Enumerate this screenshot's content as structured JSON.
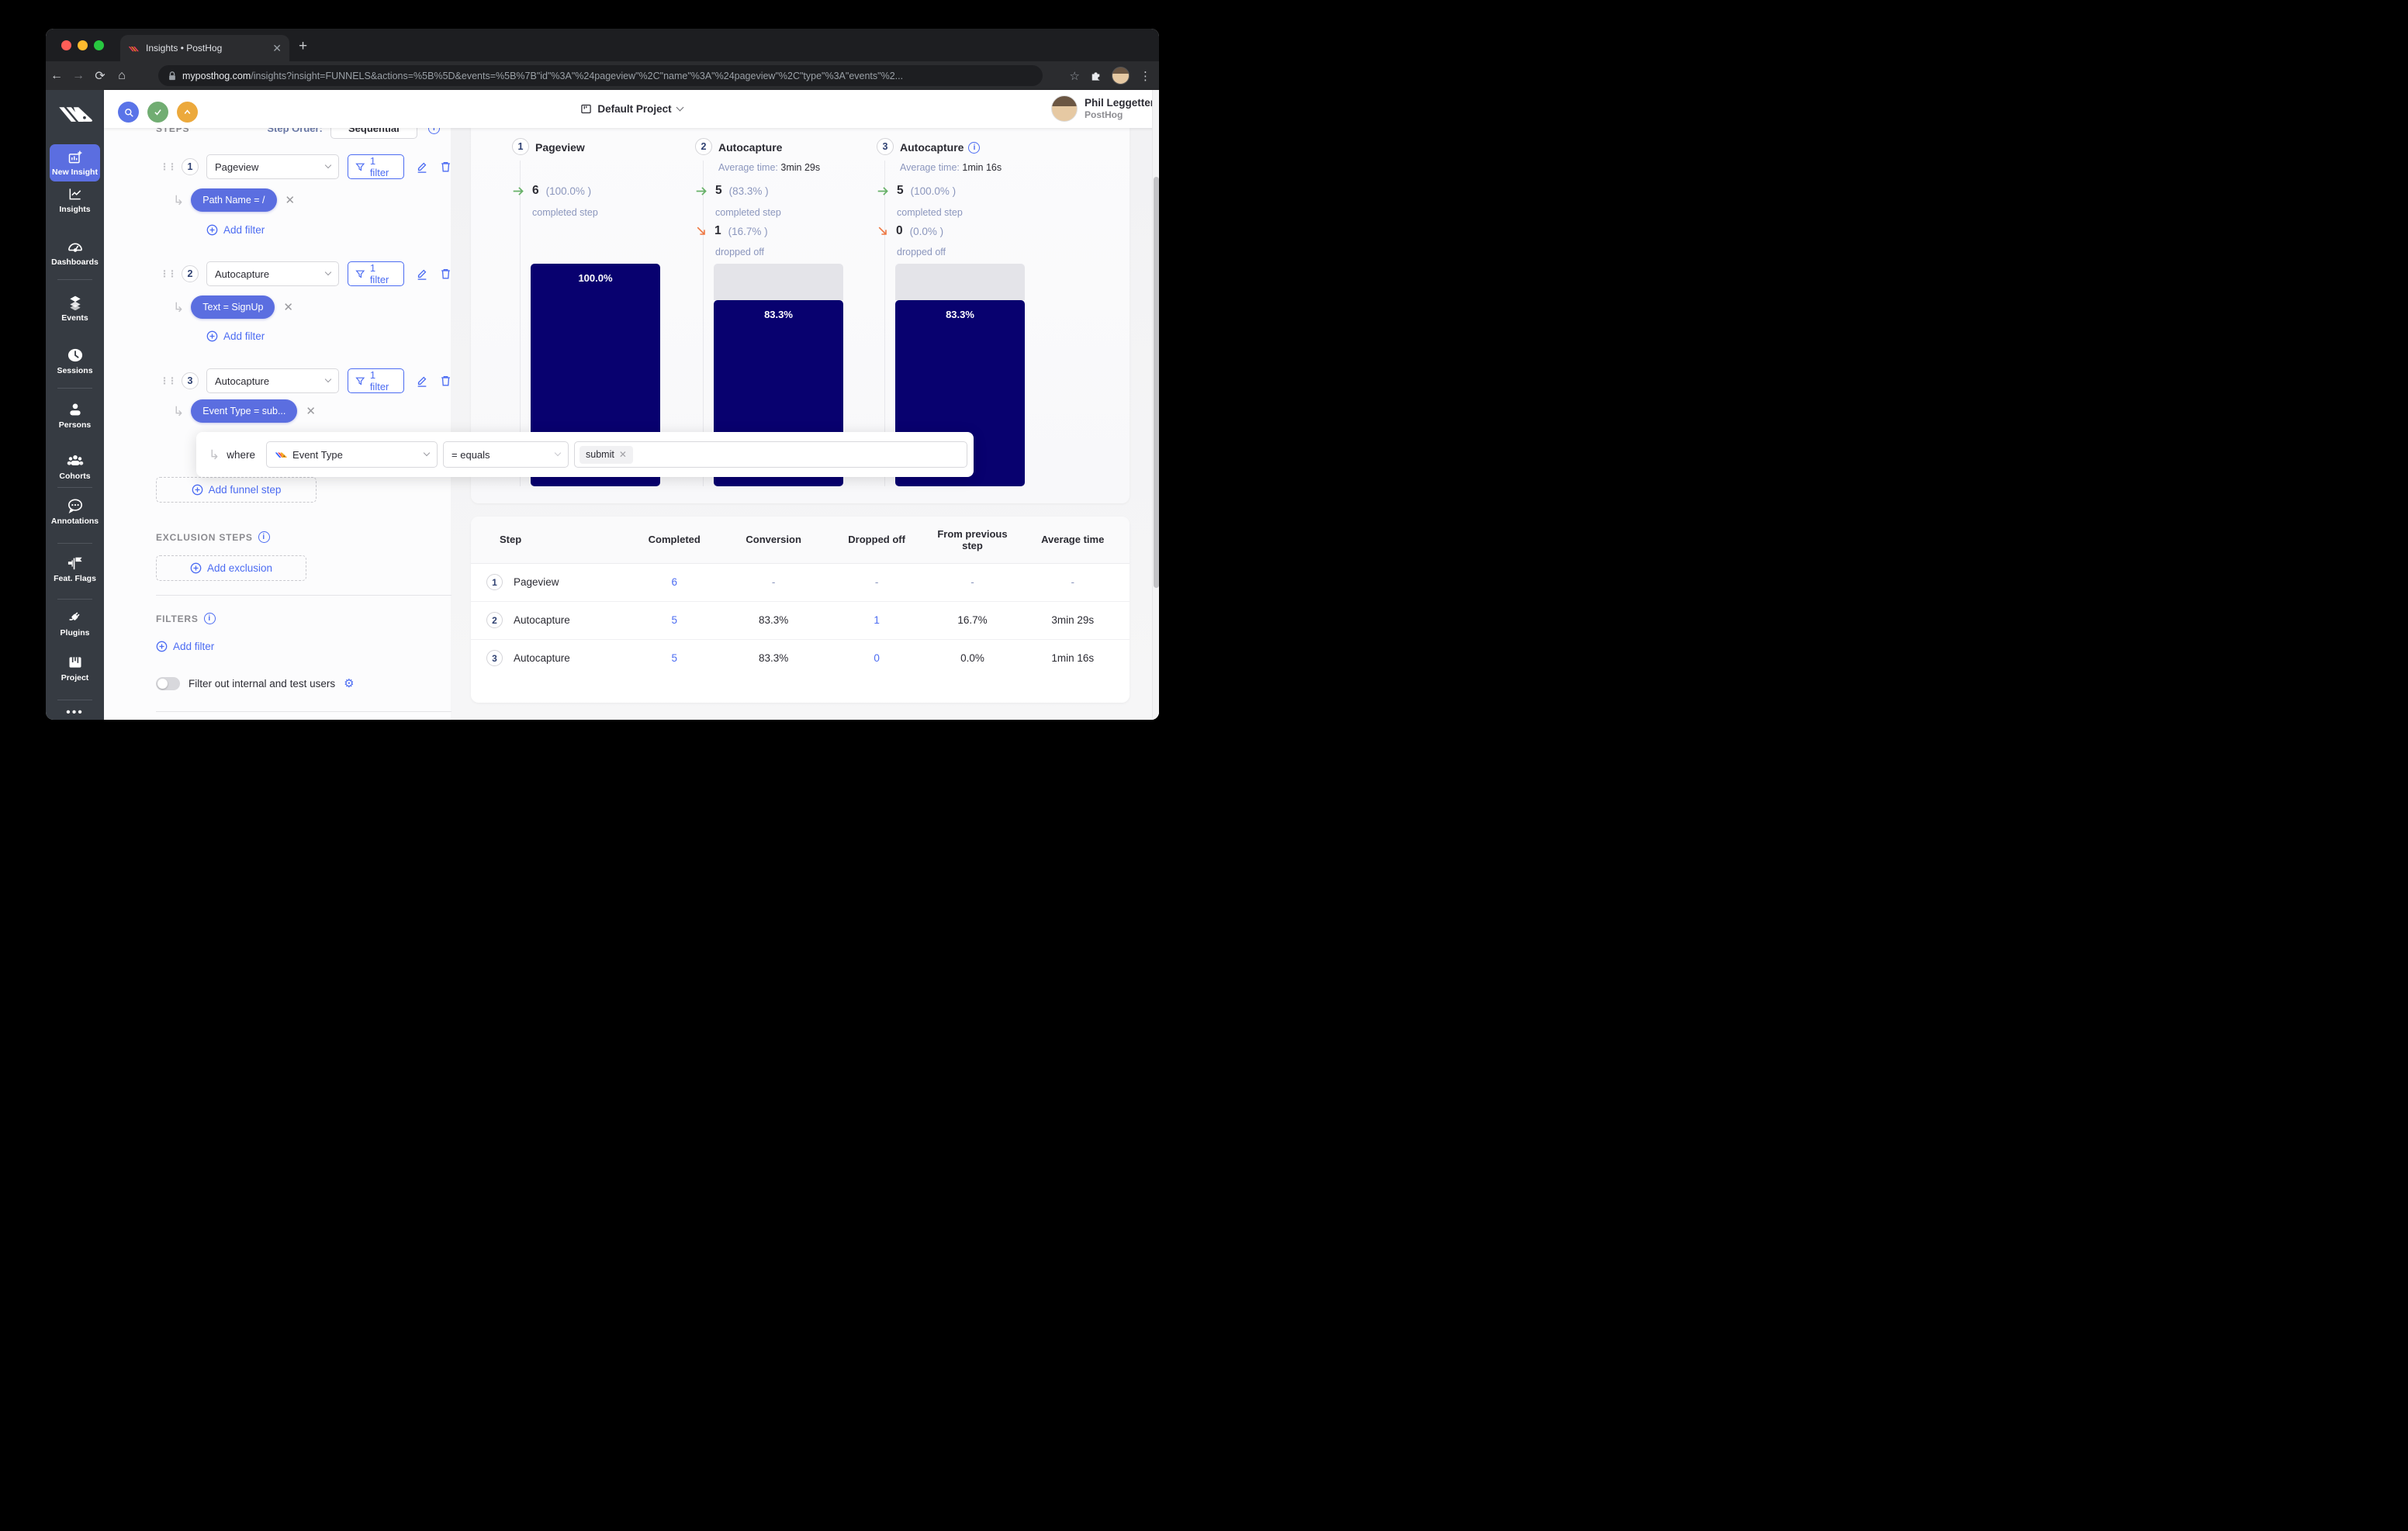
{
  "browser": {
    "tab_title": "Insights • PostHog",
    "new_tab_label": "+",
    "url_domain": "myposthog.com",
    "url_path": "/insights?insight=FUNNELS&actions=%5B%5D&events=%5B%7B\"id\"%3A\"%24pageview\"%2C\"name\"%3A\"%24pageview\"%2C\"type\"%3A\"events\"%2..."
  },
  "sidebar": {
    "items": [
      {
        "label": "New Insight"
      },
      {
        "label": "Insights"
      },
      {
        "label": "Dashboards"
      },
      {
        "label": "Events"
      },
      {
        "label": "Sessions"
      },
      {
        "label": "Persons"
      },
      {
        "label": "Cohorts"
      },
      {
        "label": "Annotations"
      },
      {
        "label": "Feat. Flags"
      },
      {
        "label": "Plugins"
      },
      {
        "label": "Project"
      }
    ]
  },
  "header": {
    "project_name": "Default Project",
    "user_name": "Phil Leggetter",
    "user_org": "PostHog"
  },
  "config": {
    "section_label": "STEPS",
    "step_order_label": "Step Order:",
    "step_order_value": "Sequential",
    "steps": [
      {
        "num": "1",
        "event": "Pageview",
        "filter_button": "1 filter",
        "pill": "Path Name = /",
        "add_filter": "Add filter"
      },
      {
        "num": "2",
        "event": "Autocapture",
        "filter_button": "1 filter",
        "pill": "Text = SignUp",
        "add_filter": "Add filter"
      },
      {
        "num": "3",
        "event": "Autocapture",
        "filter_button": "1 filter",
        "pill": "Event Type = sub..."
      }
    ],
    "where_row": {
      "prefix": "where",
      "property": "Event Type",
      "operator": "= equals",
      "value_tag": "submit"
    },
    "add_funnel_step": "Add funnel step",
    "exclusions": {
      "label": "EXCLUSION STEPS",
      "button": "Add exclusion"
    },
    "filters": {
      "label": "FILTERS",
      "add_filter": "Add filter",
      "toggle_label": "Filter out internal and test users"
    }
  },
  "funnel": {
    "columns": [
      {
        "num": "1",
        "title": "Pageview",
        "completed": "6",
        "completed_pct": "(100.0% )",
        "completed_label": "completed step",
        "bar_label": "100.0%"
      },
      {
        "num": "2",
        "title": "Autocapture",
        "avg_time_label": "Average time:",
        "avg_time": "3min 29s",
        "completed": "5",
        "completed_pct": "(83.3% )",
        "completed_label": "completed step",
        "dropped": "1",
        "dropped_pct": "(16.7% )",
        "dropped_label": "dropped off",
        "bar_label": "83.3%"
      },
      {
        "num": "3",
        "title": "Autocapture",
        "avg_time_label": "Average time:",
        "avg_time": "1min 16s",
        "completed": "5",
        "completed_pct": "(100.0% )",
        "completed_label": "completed step",
        "dropped": "0",
        "dropped_pct": "(0.0% )",
        "dropped_label": "dropped off",
        "bar_label": "83.3%"
      }
    ]
  },
  "table": {
    "headers": [
      "Step",
      "Completed",
      "Conversion",
      "Dropped off",
      "From previous step",
      "Average time"
    ],
    "rows": [
      {
        "num": "1",
        "step": "Pageview",
        "completed": "6",
        "conversion": "-",
        "dropped_off": "-",
        "from_previous": "-",
        "average_time": "-"
      },
      {
        "num": "2",
        "step": "Autocapture",
        "completed": "5",
        "conversion": "83.3%",
        "dropped_off": "1",
        "from_previous": "16.7%",
        "average_time": "3min 29s"
      },
      {
        "num": "3",
        "step": "Autocapture",
        "completed": "5",
        "conversion": "83.3%",
        "dropped_off": "0",
        "from_previous": "0.0%",
        "average_time": "1min 16s"
      }
    ]
  },
  "colors": {
    "accent_blue": "#4c6cf2",
    "pill_blue": "#5b6ee0",
    "bar_navy": "#08016f",
    "dropped_gray": "#e4e4e9",
    "muted_indigo": "#8b96bd",
    "success_green": "#67b168",
    "warning_orange": "#ee7742"
  }
}
